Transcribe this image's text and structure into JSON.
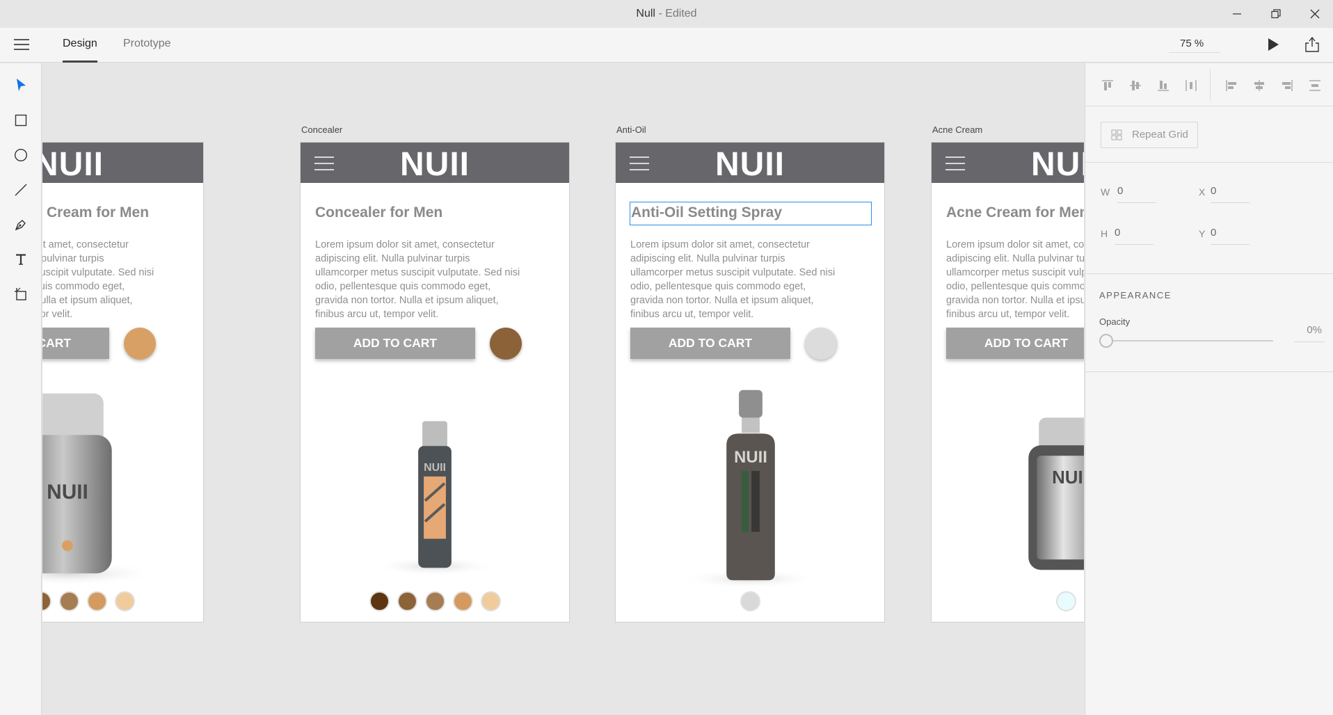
{
  "window": {
    "title": "Null",
    "subtitle": "- Edited"
  },
  "menu": {
    "tabs": [
      {
        "label": "Design",
        "active": true
      },
      {
        "label": "Prototype",
        "active": false
      }
    ],
    "zoom": "75 %"
  },
  "tools": [
    "select-icon",
    "rectangle-icon",
    "ellipse-icon",
    "line-icon",
    "pen-icon",
    "text-icon",
    "artboard-icon"
  ],
  "artboards": [
    {
      "label": "",
      "logo": "NUII",
      "title": "Hydrating BB Cream for Men",
      "body": "Lorem ipsum dolor sit amet, consectetur adipiscing elit. Nulla pulvinar turpis ullamcorper metus suscipit vulputate. Sed nisi odio, pellentesque quis commodo eget, gravida non tortor. Nulla et ipsum aliquet, finibus arcu ut, tempor velit.",
      "cart": "ADD TO CART",
      "swatch": "#d9a066",
      "product_label": "NUII",
      "dots": [
        "#5e3511",
        "#8c6239",
        "#a67c52",
        "#d49a5f",
        "#f0cc9c"
      ]
    },
    {
      "label": "Concealer",
      "logo": "NUII",
      "title": "Concealer for Men",
      "body": "Lorem ipsum dolor sit amet, consectetur adipiscing elit. Nulla pulvinar turpis ullamcorper metus suscipit vulputate. Sed nisi odio, pellentesque quis commodo eget, gravida non tortor. Nulla et ipsum aliquet, finibus arcu ut, tempor velit.",
      "cart": "ADD TO CART",
      "swatch": "#8c6239",
      "product_label": "NUII",
      "dots": [
        "#5e3511",
        "#8c6239",
        "#a67c52",
        "#d49a5f",
        "#f0cc9c"
      ]
    },
    {
      "label": "Anti-Oil",
      "logo": "NUII",
      "title": "Anti-Oil Setting Spray",
      "body": "Lorem ipsum dolor sit amet, consectetur adipiscing elit. Nulla pulvinar turpis ullamcorper metus suscipit vulputate. Sed nisi odio, pellentesque quis commodo eget, gravida non tortor. Nulla et ipsum aliquet, finibus arcu ut, tempor velit.",
      "cart": "ADD TO CART",
      "swatch": "#dcdcdc",
      "product_label": "NUII",
      "dots": [
        "#d9d9d9"
      ]
    },
    {
      "label": "Acne Cream",
      "logo": "NUII",
      "title": "Acne Cream for Men",
      "body": "Lorem ipsum dolor sit amet, consectetur adipiscing elit. Nulla pulvinar turpis ullamcorper metus suscipit vulputate. Sed nisi odio, pellentesque quis commodo eget, gravida non tortor. Nulla et ipsum aliquet, finibus arcu ut, tempor velit.",
      "cart": "ADD TO CART",
      "swatch": "",
      "product_label": "NUII",
      "dots": [
        "#e8fbff"
      ]
    }
  ],
  "panel": {
    "repeat_grid": "Repeat Grid",
    "w_label": "W",
    "w_value": "0",
    "x_label": "X",
    "x_value": "0",
    "h_label": "H",
    "h_value": "0",
    "y_label": "Y",
    "y_value": "0",
    "appearance": "APPEARANCE",
    "opacity_label": "Opacity",
    "opacity_value": "0%"
  },
  "colors": {
    "accent": "#2d8ceb",
    "header": "#67676b"
  }
}
